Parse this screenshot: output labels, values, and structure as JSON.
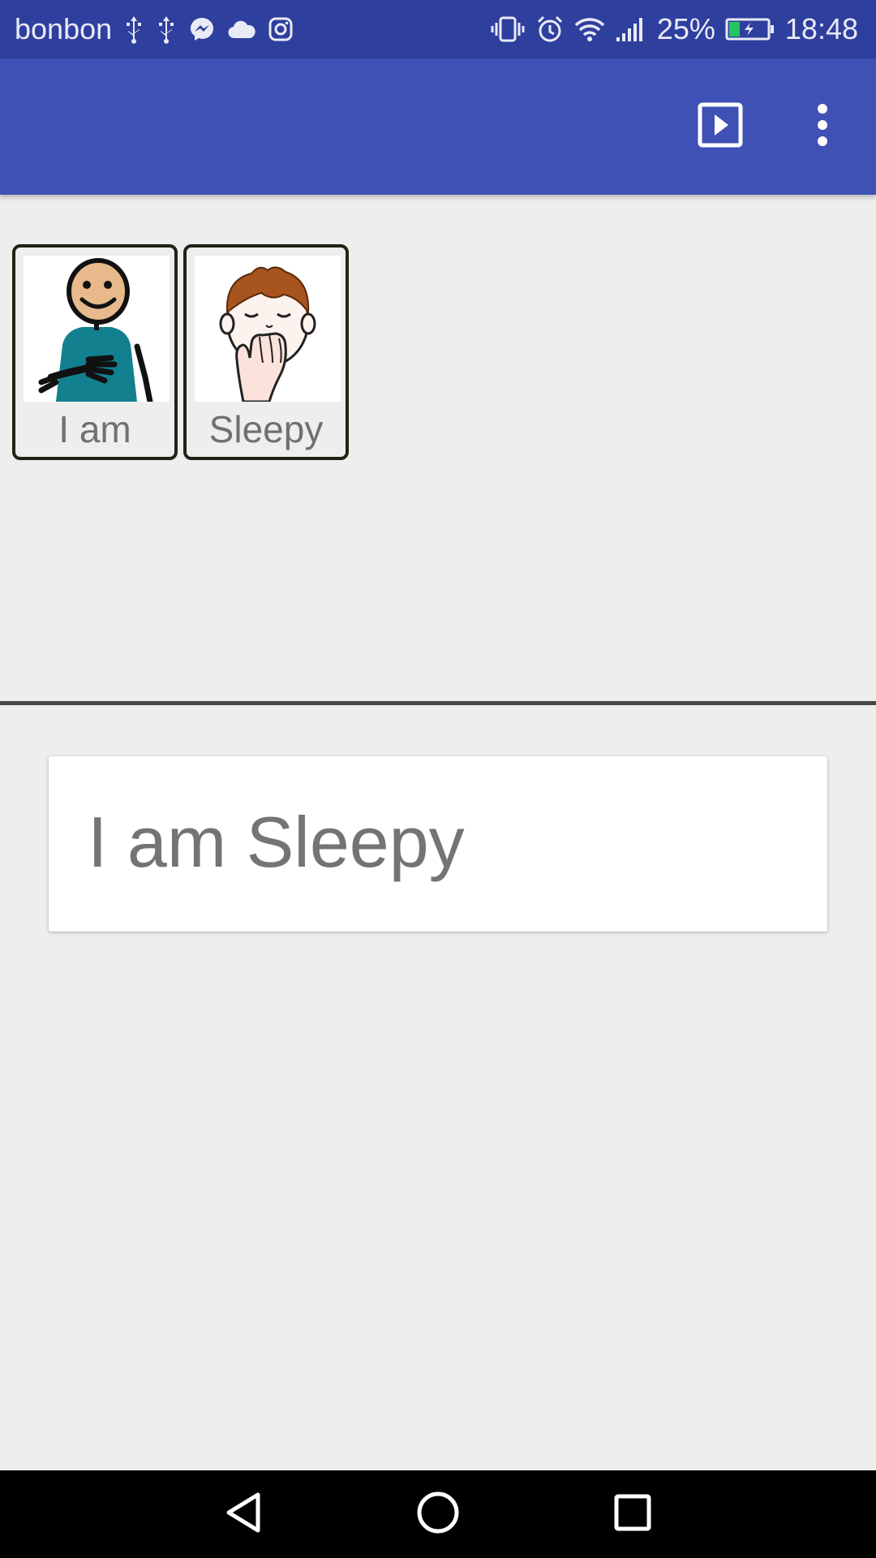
{
  "status_bar": {
    "carrier": "bonbon",
    "battery_percent": "25%",
    "battery_level": 0.25,
    "time": "18:48",
    "left_icons": [
      "usb-icon",
      "usb-icon",
      "messenger-icon",
      "cloud-icon",
      "instagram-icon"
    ],
    "right_icons": [
      "vibrate-icon",
      "alarm-icon",
      "wifi-icon",
      "signal-icon",
      "battery-charging-icon"
    ]
  },
  "app_bar": {
    "background_color": "#3f51b5",
    "actions": [
      "play-icon",
      "more-vert-icon"
    ]
  },
  "symbols": [
    {
      "label": "I am",
      "icon": "person-pointing-self-icon"
    },
    {
      "label": "Sleepy",
      "icon": "yawning-boy-icon"
    }
  ],
  "sentence": {
    "text": "I am Sleepy"
  },
  "nav_bar": {
    "buttons": [
      "back-icon",
      "home-icon",
      "recents-icon"
    ]
  },
  "colors": {
    "status_bar": "#2f3f9e",
    "app_bar": "#3f51b5",
    "background": "#eeeeee",
    "card_border": "#1f2414",
    "text": "#747474"
  }
}
